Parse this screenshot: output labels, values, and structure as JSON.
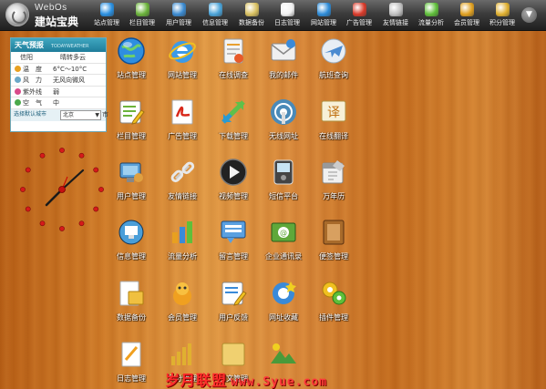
{
  "logo": {
    "en": "WebOs",
    "cn": "建站宝典"
  },
  "nav": [
    {
      "label": "站点管理",
      "icon": "globe-icon",
      "color": "#2a8fe0"
    },
    {
      "label": "栏目管理",
      "icon": "list-edit-icon",
      "color": "#6bb33b"
    },
    {
      "label": "用户管理",
      "icon": "users-icon",
      "color": "#3b8ad0"
    },
    {
      "label": "信息管理",
      "icon": "monitor-icon",
      "color": "#4aa3d8"
    },
    {
      "label": "数据备份",
      "icon": "database-icon",
      "color": "#d8c060"
    },
    {
      "label": "日志管理",
      "icon": "log-icon",
      "color": "#f0f0f0"
    },
    {
      "label": "网站管理",
      "icon": "ie-icon",
      "color": "#2e8cd8"
    },
    {
      "label": "广告管理",
      "icon": "pdf-icon",
      "color": "#d83a2a"
    },
    {
      "label": "友情链接",
      "icon": "link-icon",
      "color": "#c0c0c0"
    },
    {
      "label": "流量分析",
      "icon": "bar-chart-icon",
      "color": "#5fbf3a"
    },
    {
      "label": "会员管理",
      "icon": "member-icon",
      "color": "#e0a020"
    },
    {
      "label": "积分管理",
      "icon": "score-icon",
      "color": "#e0b030"
    }
  ],
  "weather": {
    "title": "天气预报",
    "subtitle": "TODAYWEATHER",
    "city": "信阳",
    "condition": "晴转多云",
    "rows": [
      {
        "key": "温　度",
        "value": "6°C～10°C",
        "icon": "sun-icon",
        "color": "#e8a020"
      },
      {
        "key": "风　力",
        "value": "无风向微风",
        "icon": "wind-icon",
        "color": "#6aa8c8"
      },
      {
        "key": "紫外线",
        "value": "弱",
        "icon": "uv-icon",
        "color": "#d84a8a"
      },
      {
        "key": "空　气",
        "value": "中",
        "icon": "air-icon",
        "color": "#4aa84a"
      }
    ],
    "select_city_link": "选择默认城市",
    "selected_city": "北京",
    "suffix": "市"
  },
  "apps": [
    {
      "label": "站点管理",
      "icon": "globe-icon"
    },
    {
      "label": "网站管理",
      "icon": "ie-icon"
    },
    {
      "label": "在线调查",
      "icon": "survey-icon"
    },
    {
      "label": "我的邮件",
      "icon": "mail-icon"
    },
    {
      "label": "航班查询",
      "icon": "plane-icon"
    },
    {
      "label": "栏目管理",
      "icon": "list-edit-icon"
    },
    {
      "label": "广告管理",
      "icon": "pdf-icon"
    },
    {
      "label": "下载管理",
      "icon": "download-icon"
    },
    {
      "label": "无线网址",
      "icon": "wireless-icon"
    },
    {
      "label": "在线翻译",
      "icon": "translate-icon"
    },
    {
      "label": "用户管理",
      "icon": "users-icon"
    },
    {
      "label": "友情链接",
      "icon": "link-icon"
    },
    {
      "label": "视频管理",
      "icon": "play-icon"
    },
    {
      "label": "短信平台",
      "icon": "phone-icon"
    },
    {
      "label": "万年历",
      "icon": "calendar-icon"
    },
    {
      "label": "信息管理",
      "icon": "monitor-icon"
    },
    {
      "label": "流量分析",
      "icon": "bar-chart-icon"
    },
    {
      "label": "留言管理",
      "icon": "message-icon"
    },
    {
      "label": "企业通讯录",
      "icon": "contacts-icon"
    },
    {
      "label": "便签管理",
      "icon": "notes-icon"
    },
    {
      "label": "数据备份",
      "icon": "backup-icon"
    },
    {
      "label": "会员管理",
      "icon": "member-icon"
    },
    {
      "label": "用户反馈",
      "icon": "feedback-icon"
    },
    {
      "label": "网址收藏",
      "icon": "favorites-icon"
    },
    {
      "label": "插件管理",
      "icon": "plugin-icon"
    },
    {
      "label": "日志管理",
      "icon": "log-icon"
    },
    {
      "label": "积分管理",
      "icon": "score-icon"
    },
    {
      "label": "图文管理",
      "icon": "folder-icon"
    },
    {
      "label": "",
      "icon": "landscape-icon"
    }
  ],
  "watermark": {
    "text": "岁月联盟",
    "url": "www.Syue.com"
  }
}
